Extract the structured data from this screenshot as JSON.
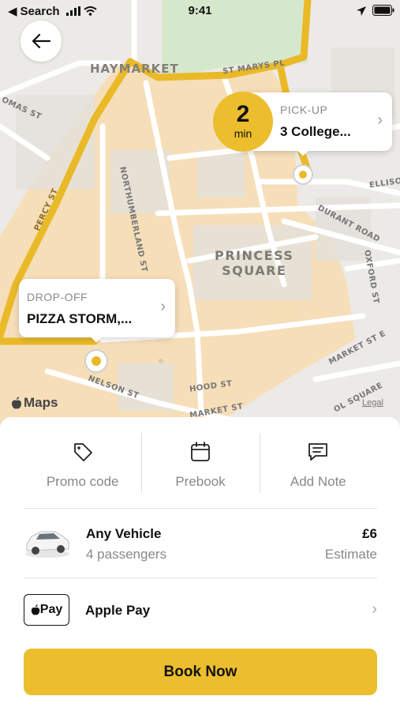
{
  "status_bar": {
    "back_app": "Search",
    "time": "9:41"
  },
  "map": {
    "streets": [
      "HAYMARKET",
      "ST MARYS PL",
      "OMAS ST",
      "NORTHUMBERLAND ST",
      "PERCY ST",
      "ELLISON",
      "DURANT ROAD",
      "OXFORD ST",
      "MARKET ST E",
      "NELSON ST",
      "HOOD ST",
      "MARKET ST",
      "OL SQUARE"
    ],
    "area_label": "PRINCESS\nSQUARE",
    "brand": "Maps",
    "legal": "Legal"
  },
  "eta": {
    "value": "2",
    "unit": "min"
  },
  "pickup": {
    "kind": "PICK-UP",
    "place": "3 College..."
  },
  "dropoff": {
    "kind": "DROP-OFF",
    "place": "PIZZA STORM,..."
  },
  "actions": [
    {
      "label": "Promo code",
      "icon": "tag-icon"
    },
    {
      "label": "Prebook",
      "icon": "calendar-icon"
    },
    {
      "label": "Add Note",
      "icon": "note-icon"
    }
  ],
  "vehicle": {
    "title": "Any Vehicle",
    "subtitle": "4 passengers",
    "price": "£6",
    "price_note": "Estimate"
  },
  "payment": {
    "badge": "Pay",
    "title": "Apple Pay"
  },
  "book_button": "Book Now",
  "colors": {
    "accent": "#ecbe2e",
    "route": "#e9b928",
    "zone": "#f8dcb0"
  }
}
